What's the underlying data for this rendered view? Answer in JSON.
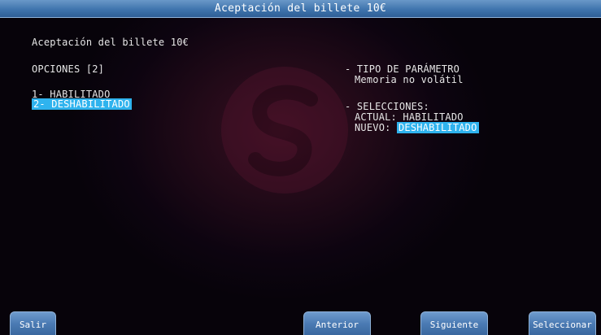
{
  "window": {
    "title": "Aceptación del billete 10€"
  },
  "main": {
    "heading": "Aceptación del billete 10€",
    "options_label": "OPCIONES [2]",
    "options": [
      {
        "label": "1- HABILITADO",
        "selected": false
      },
      {
        "label": "2- DESHABILITADO",
        "selected": true
      }
    ]
  },
  "param_info": {
    "type_title": "- TIPO DE PARÁMETRO",
    "type_value": "Memoria no volátil",
    "selections_title": "- SELECCIONES:",
    "current_label": "ACTUAL:",
    "current_value": "HABILITADO",
    "new_label": "NUEVO:",
    "new_value": "DESHABILITADO"
  },
  "buttons": {
    "exit": "Salir",
    "previous": "Anterior",
    "next": "Siguiente",
    "select": "Seleccionar"
  },
  "colors": {
    "title_bar": "#3f74ad",
    "highlight": "#2fb3ee",
    "button": "#4b7bb4",
    "background": "#0d0410"
  }
}
